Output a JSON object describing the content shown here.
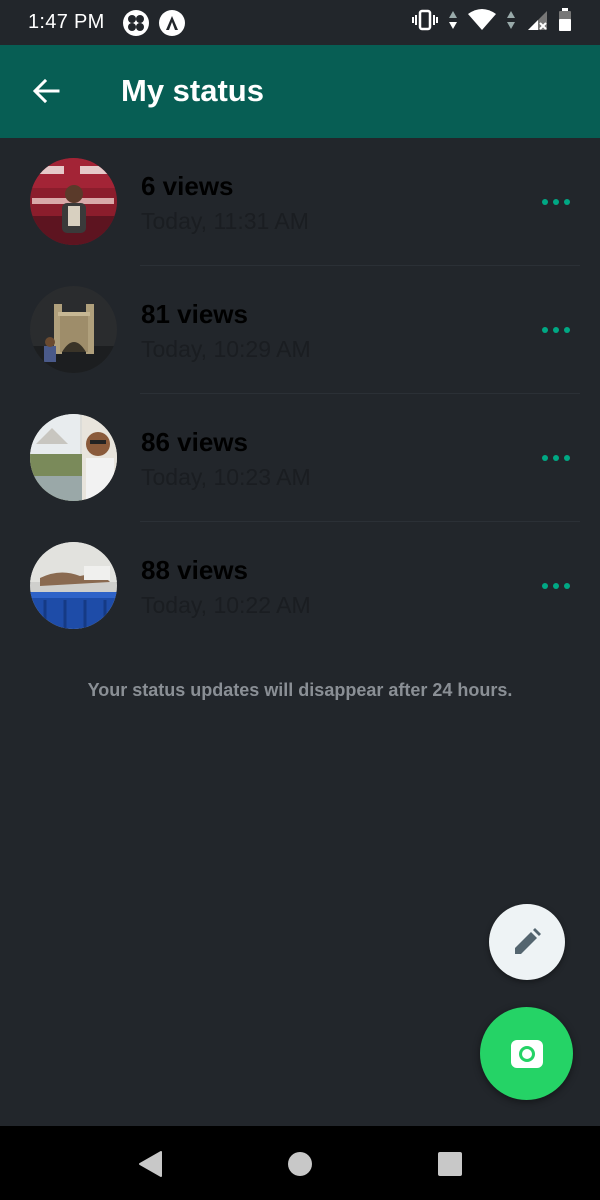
{
  "status_bar": {
    "time": "1:47 PM",
    "left_icons": [
      "fan-icon",
      "a-icon"
    ],
    "right_icons": [
      "vibrate-icon",
      "data-arrows-icon",
      "wifi-icon",
      "signal-icon",
      "battery-icon"
    ]
  },
  "header": {
    "title": "My status",
    "back_icon": "arrow-left-icon"
  },
  "statuses": [
    {
      "views": "6 views",
      "time": "Today, 11:31 AM",
      "more_icon": "more-horizontal-icon"
    },
    {
      "views": "81 views",
      "time": "Today, 10:29 AM",
      "more_icon": "more-horizontal-icon"
    },
    {
      "views": "86 views",
      "time": "Today, 10:23 AM",
      "more_icon": "more-horizontal-icon"
    },
    {
      "views": "88 views",
      "time": "Today, 10:22 AM",
      "more_icon": "more-horizontal-icon"
    }
  ],
  "info_text": "Your status updates will disappear after 24 hours.",
  "fab": {
    "edit_icon": "pencil-icon",
    "camera_icon": "camera-icon"
  },
  "nav": {
    "back_icon": "triangle-back-icon",
    "home_icon": "circle-home-icon",
    "recents_icon": "square-recents-icon"
  },
  "colors": {
    "app_bar": "#075e54",
    "background": "#22262b",
    "accent_green": "#25d366",
    "dots": "#00a884"
  }
}
